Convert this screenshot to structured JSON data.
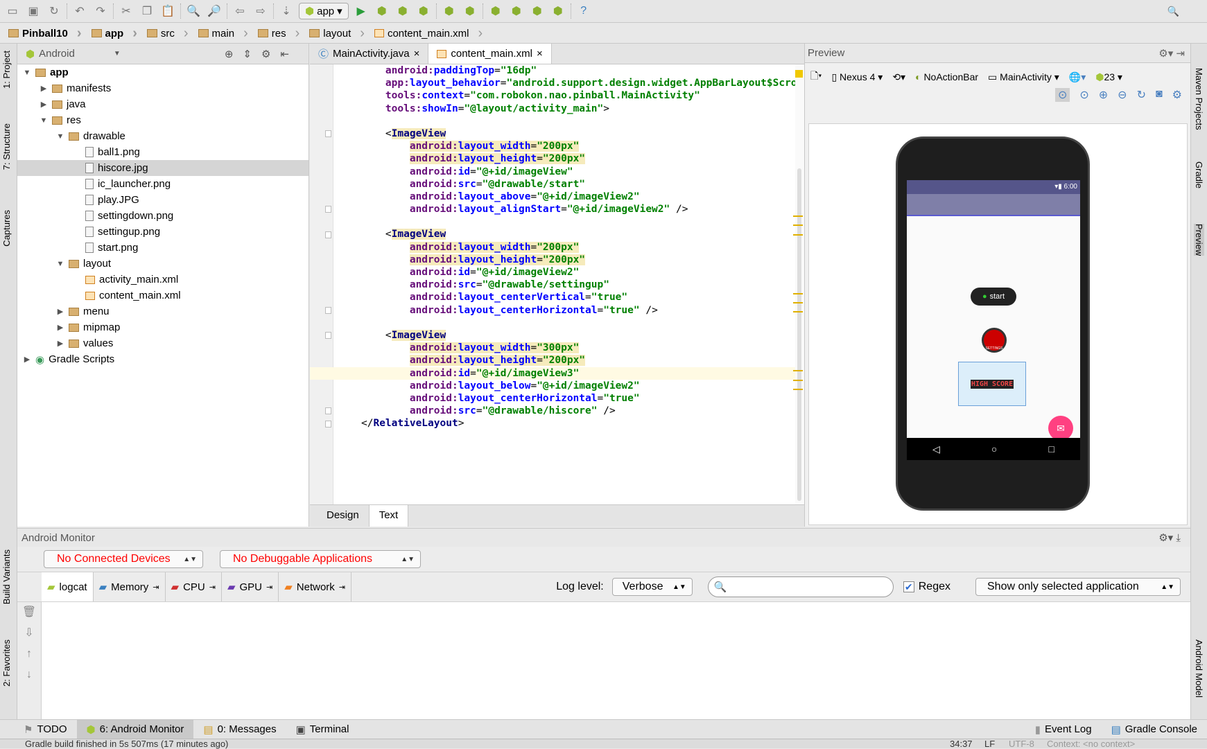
{
  "toolbar": {
    "run_config": "app",
    "icons": [
      "open-folder-icon",
      "save-icon",
      "sync-icon",
      "undo-icon",
      "redo-icon",
      "cut-icon",
      "copy-icon",
      "paste-icon",
      "find-icon",
      "replace-icon",
      "back-icon",
      "forward-icon",
      "make-icon",
      "run-icon",
      "debug-icon",
      "attach-icon",
      "device-icon",
      "sdk-manager-icon",
      "structure-icon",
      "gradle-sync-icon",
      "avd-icon",
      "sdk-icon",
      "android-icon",
      "help-icon"
    ]
  },
  "breadcrumb": [
    "Pinball10",
    "app",
    "src",
    "main",
    "res",
    "layout",
    "content_main.xml"
  ],
  "left_stripe": [
    "1: Project",
    "7: Structure",
    "Captures",
    "Build Variants",
    "2: Favorites"
  ],
  "right_stripe": [
    "Maven Projects",
    "Gradle",
    "Preview",
    "Android Model"
  ],
  "project": {
    "view": "Android",
    "tree": [
      {
        "label": "app",
        "depth": 0,
        "expanded": true,
        "type": "module"
      },
      {
        "label": "manifests",
        "depth": 1,
        "expanded": false,
        "type": "folder"
      },
      {
        "label": "java",
        "depth": 1,
        "expanded": false,
        "type": "folder"
      },
      {
        "label": "res",
        "depth": 1,
        "expanded": true,
        "type": "folder"
      },
      {
        "label": "drawable",
        "depth": 2,
        "expanded": true,
        "type": "folder"
      },
      {
        "label": "ball1.png",
        "depth": 3,
        "type": "file"
      },
      {
        "label": "hiscore.jpg",
        "depth": 3,
        "type": "file",
        "selected": true
      },
      {
        "label": "ic_launcher.png",
        "depth": 3,
        "type": "file"
      },
      {
        "label": "play.JPG",
        "depth": 3,
        "type": "file"
      },
      {
        "label": "settingdown.png",
        "depth": 3,
        "type": "file"
      },
      {
        "label": "settingup.png",
        "depth": 3,
        "type": "file"
      },
      {
        "label": "start.png",
        "depth": 3,
        "type": "file"
      },
      {
        "label": "layout",
        "depth": 2,
        "expanded": true,
        "type": "folder"
      },
      {
        "label": "activity_main.xml",
        "depth": 3,
        "type": "xml"
      },
      {
        "label": "content_main.xml",
        "depth": 3,
        "type": "xml"
      },
      {
        "label": "menu",
        "depth": 2,
        "expanded": false,
        "type": "folder"
      },
      {
        "label": "mipmap",
        "depth": 2,
        "expanded": false,
        "type": "folder"
      },
      {
        "label": "values",
        "depth": 2,
        "expanded": false,
        "type": "folder"
      },
      {
        "label": "Gradle Scripts",
        "depth": 0,
        "expanded": false,
        "type": "gradle"
      }
    ]
  },
  "editor": {
    "tabs": [
      {
        "label": "MainActivity.java",
        "active": false
      },
      {
        "label": "content_main.xml",
        "active": true
      }
    ],
    "lines": [
      "    android:paddingTop=\"16dp\"",
      "    app:layout_behavior=\"android.support.design.widget.AppBarLayout$ScrollingViewBehavior\"",
      "    tools:context=\"com.robokon.nao.pinball.MainActivity\"",
      "    tools:showIn=\"@layout/activity_main\">",
      "",
      "    <ImageView",
      "        android:layout_width=\"200px\"",
      "        android:layout_height=\"200px\"",
      "        android:id=\"@+id/imageView\"",
      "        android:src=\"@drawable/start\"",
      "        android:layout_above=\"@+id/imageView2\"",
      "        android:layout_alignStart=\"@+id/imageView2\" />",
      "",
      "    <ImageView",
      "        android:layout_width=\"200px\"",
      "        android:layout_height=\"200px\"",
      "        android:id=\"@+id/imageView2\"",
      "        android:src=\"@drawable/settingup\"",
      "        android:layout_centerVertical=\"true\"",
      "        android:layout_centerHorizontal=\"true\" />",
      "",
      "    <ImageView",
      "        android:layout_width=\"300px\"",
      "        android:layout_height=\"200px\"",
      "        android:id=\"@+id/imageView3\"",
      "        android:layout_below=\"@+id/imageView2\"",
      "        android:layout_centerHorizontal=\"true\"",
      "        android:src=\"@drawable/hiscore\" />",
      "</RelativeLayout>"
    ],
    "current_line": 24,
    "bottom_tabs": [
      {
        "label": "Design",
        "active": false
      },
      {
        "label": "Text",
        "active": true
      }
    ]
  },
  "preview": {
    "title": "Preview",
    "device": "Nexus 4",
    "theme": "NoActionBar",
    "activity": "MainActivity",
    "api": "23",
    "phone": {
      "time": "6:00",
      "start_label": "start",
      "setting_label": "SETTINGS",
      "hiscore_label": "HIGH SCORE"
    }
  },
  "monitor": {
    "title": "Android Monitor",
    "devices": "No Connected Devices",
    "apps": "No Debuggable Applications",
    "tabs": [
      "logcat",
      "Memory",
      "CPU",
      "GPU",
      "Network"
    ],
    "log_level_label": "Log level:",
    "log_level": "Verbose",
    "search_value": "",
    "regex_label": "Regex",
    "regex_checked": true,
    "filter": "Show only selected application"
  },
  "tool_windows": {
    "left": [
      "TODO",
      "6: Android Monitor",
      "0: Messages",
      "Terminal"
    ],
    "right": [
      "Event Log",
      "Gradle Console"
    ]
  },
  "status": {
    "message": "Gradle build finished in 5s 507ms (17 minutes ago)",
    "position": "34:37",
    "line_sep": "LF",
    "encoding": "UTF-8",
    "context": "Context: <no context>"
  },
  "colors": {
    "accent_android": "#a4c639",
    "error_text": "#ff0000",
    "fab": "#ff4081",
    "action_bar": "#7f7fa8"
  }
}
